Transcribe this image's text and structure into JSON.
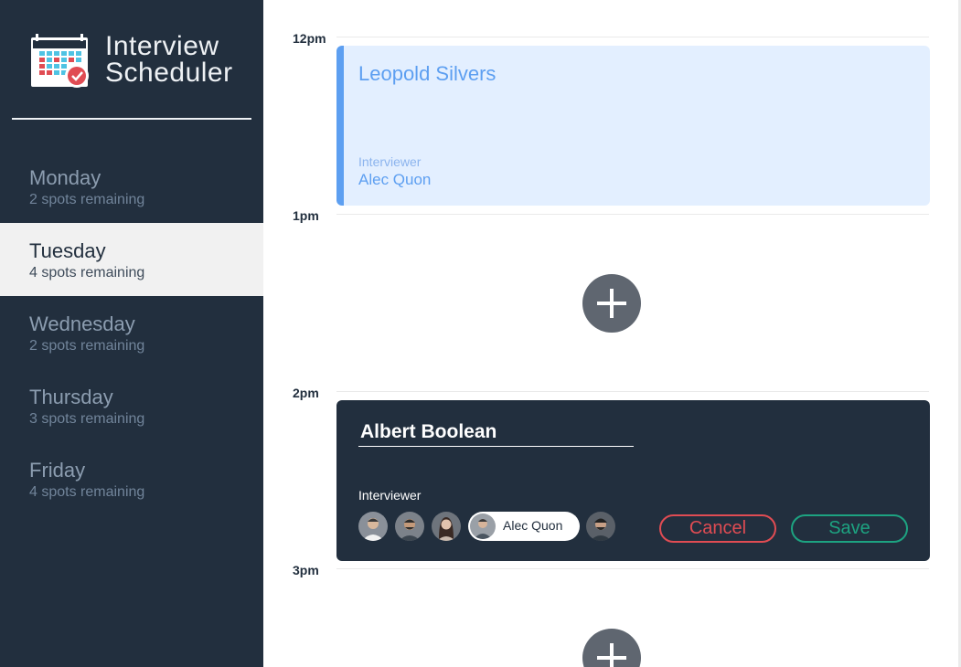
{
  "app": {
    "title_line1": "Interview",
    "title_line2": "Scheduler"
  },
  "sidebar": {
    "days": [
      {
        "name": "Monday",
        "spots": "2 spots remaining",
        "selected": false
      },
      {
        "name": "Tuesday",
        "spots": "4 spots remaining",
        "selected": true
      },
      {
        "name": "Wednesday",
        "spots": "2 spots remaining",
        "selected": false
      },
      {
        "name": "Thursday",
        "spots": "3 spots remaining",
        "selected": false
      },
      {
        "name": "Friday",
        "spots": "4 spots remaining",
        "selected": false
      }
    ]
  },
  "schedule": {
    "times": [
      "12pm",
      "1pm",
      "2pm",
      "3pm"
    ],
    "booked": {
      "student": "Leopold Silvers",
      "interviewer_label": "Interviewer",
      "interviewer": "Alec Quon"
    },
    "form": {
      "student_value": "Albert Boolean",
      "interviewer_label": "Interviewer",
      "selected_interviewer": "Alec Quon",
      "cancel_label": "Cancel",
      "save_label": "Save"
    }
  },
  "colors": {
    "sidebar_bg": "#222f3e",
    "booked_accent": "#5d9ff1",
    "cancel": "#e04c53",
    "save": "#1da381"
  },
  "icons": [
    "calendar-logo-icon",
    "add-appointment-icon",
    "interviewer-avatar"
  ]
}
